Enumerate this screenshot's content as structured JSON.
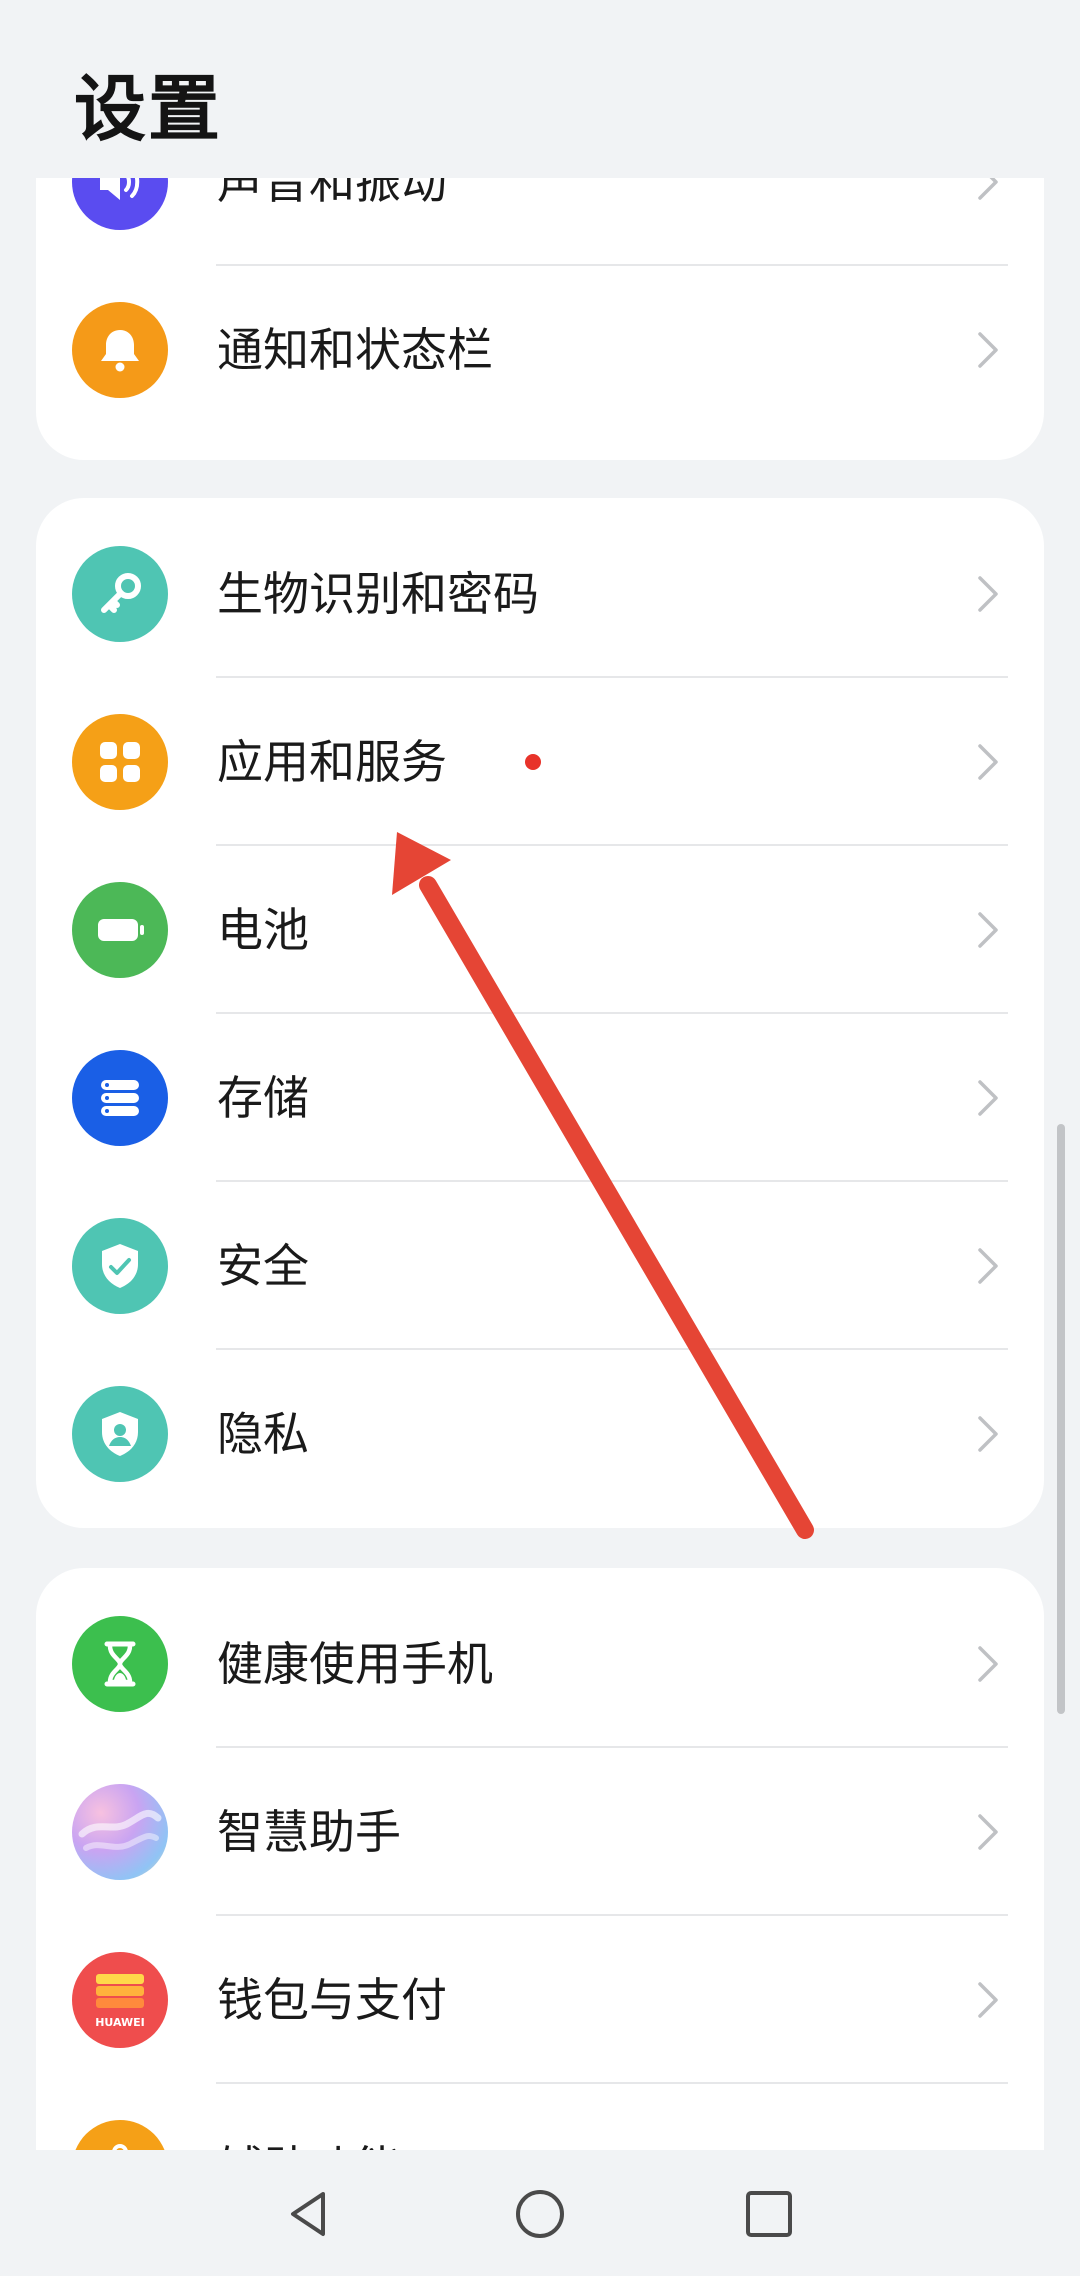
{
  "header": {
    "title": "设置"
  },
  "colors": {
    "background": "#f1f3f5",
    "card": "#ffffff",
    "arrow": "#e54535",
    "badge": "#e8332a"
  },
  "groups": [
    {
      "items": [
        {
          "label": "声音和振动",
          "icon": "speaker-icon",
          "color": "#5a4cf0"
        },
        {
          "label": "通知和状态栏",
          "icon": "bell-icon",
          "color": "#f59a18"
        }
      ]
    },
    {
      "items": [
        {
          "label": "生物识别和密码",
          "icon": "key-icon",
          "color": "#4fc5b3"
        },
        {
          "label": "应用和服务",
          "icon": "apps-grid-icon",
          "color": "#f5a017",
          "badge": true
        },
        {
          "label": "电池",
          "icon": "battery-icon",
          "color": "#4cb857"
        },
        {
          "label": "存储",
          "icon": "storage-icon",
          "color": "#1a5fe6"
        },
        {
          "label": "安全",
          "icon": "shield-check-icon",
          "color": "#4fc5b3"
        },
        {
          "label": "隐私",
          "icon": "privacy-shield-icon",
          "color": "#4fc5b3"
        }
      ]
    },
    {
      "items": [
        {
          "label": "健康使用手机",
          "icon": "hourglass-icon",
          "color": "#3cbf4e"
        },
        {
          "label": "智慧助手",
          "icon": "assistant-orb-icon",
          "color": "#c8a8f0"
        },
        {
          "label": "钱包与支付",
          "icon": "wallet-icon",
          "color": "#ef4d4d",
          "icon_text": "HUAWEI"
        },
        {
          "label": "辅助功能",
          "icon": "accessibility-icon",
          "color": "#f5a017"
        }
      ]
    }
  ],
  "navbar": {
    "back": "back-triangle-icon",
    "home": "home-circle-icon",
    "recents": "recents-square-icon"
  }
}
